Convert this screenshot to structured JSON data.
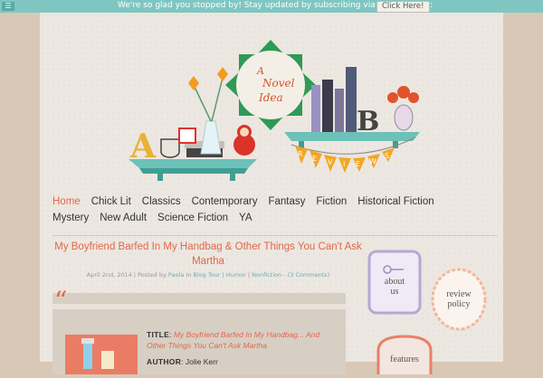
{
  "topbar": {
    "message": "We're so glad you stopped by! Stay updated by subscribing via RSS or email:",
    "cta": "Click Here!"
  },
  "header": {
    "logo_lines": [
      "A",
      "Novel",
      "Idea"
    ],
    "banner_letters": [
      "R",
      "E",
      "V",
      "I",
      "E",
      "W",
      "S"
    ]
  },
  "nav": {
    "row1": [
      "Home",
      "Chick Lit",
      "Classics",
      "Contemporary",
      "Fantasy",
      "Fiction",
      "Historical Fiction"
    ],
    "row2": [
      "Mystery",
      "New Adult",
      "Science Fiction",
      "YA"
    ]
  },
  "post": {
    "title": "My Boyfriend Barfed In My Handbag & Other Things You Can't Ask Martha",
    "meta_date": "April 2nd, 2014 | Posted by",
    "meta_author": "Paola",
    "meta_in": "in",
    "meta_cat1": "Blog Tour",
    "meta_cat2": "Humor",
    "meta_cat3": "Nonfiction",
    "meta_comments": "(3 Comments)",
    "quote_mark": "“",
    "title_label": "TITLE",
    "title_value": "My Boyfriend Barfed In My Handbag... And Other Things You Can't Ask Martha",
    "author_label": "AUTHOR",
    "author_value": "Jolie Kerr"
  },
  "sidebar": {
    "about": [
      "about",
      "us"
    ],
    "review": [
      "review",
      "policy"
    ],
    "features": "features"
  },
  "colors": {
    "accent": "#e2674a",
    "teal": "#7fc6c3",
    "link": "#69aec0"
  }
}
